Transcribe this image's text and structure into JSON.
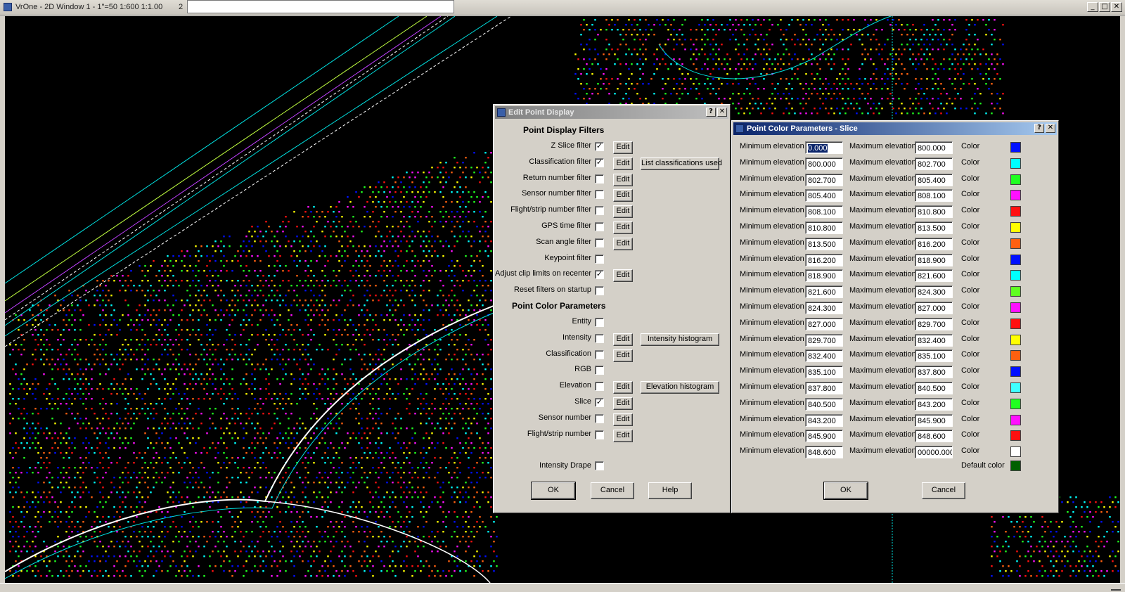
{
  "window": {
    "title": "VrOne - 2D Window 1 - 1\"=50  1:600  1:1.00",
    "title_suffix": "2",
    "minimize": "_",
    "maximize": "□",
    "close": "✕"
  },
  "edit_dialog": {
    "title": "Edit Point Display",
    "help_btn": "?",
    "close_btn": "✕",
    "filters_heading": "Point Display Filters",
    "filters": [
      {
        "label": "Z Slice filter",
        "checked": true,
        "edit": "Edit"
      },
      {
        "label": "Classification filter",
        "checked": true,
        "edit": "Edit",
        "extra": "List classifications used"
      },
      {
        "label": "Return number filter",
        "checked": false,
        "edit": "Edit"
      },
      {
        "label": "Sensor number filter",
        "checked": false,
        "edit": "Edit"
      },
      {
        "label": "Flight/strip number filter",
        "checked": false,
        "edit": "Edit"
      },
      {
        "label": "GPS time filter",
        "checked": false,
        "edit": "Edit"
      },
      {
        "label": "Scan angle filter",
        "checked": false,
        "edit": "Edit"
      },
      {
        "label": "Keypoint filter",
        "checked": false,
        "edit": ""
      },
      {
        "label": "Adjust clip limits on recenter",
        "checked": true,
        "edit": "Edit"
      },
      {
        "label": "Reset filters on startup",
        "checked": false,
        "edit": ""
      }
    ],
    "color_heading": "Point Color Parameters",
    "color_modes": [
      {
        "label": "Entity",
        "checked": false,
        "edit": ""
      },
      {
        "label": "Intensity",
        "checked": false,
        "edit": "Edit",
        "extra": "Intensity histogram"
      },
      {
        "label": "Classification",
        "checked": false,
        "edit": "Edit"
      },
      {
        "label": "RGB",
        "checked": false,
        "edit": ""
      },
      {
        "label": "Elevation",
        "checked": false,
        "edit": "Edit",
        "extra": "Elevation histogram"
      },
      {
        "label": "Slice",
        "checked": true,
        "edit": "Edit"
      },
      {
        "label": "Sensor number",
        "checked": false,
        "edit": "Edit"
      },
      {
        "label": "Flight/strip number",
        "checked": false,
        "edit": "Edit"
      }
    ],
    "drape": {
      "label": "Intensity Drape",
      "checked": false
    },
    "ok": "OK",
    "cancel": "Cancel",
    "help": "Help"
  },
  "slice_dialog": {
    "title": "Point Color Parameters - Slice",
    "help_btn": "?",
    "close_btn": "✕",
    "min_label": "Minimum elevation",
    "max_label": "Maximum elevation",
    "color_label": "Color",
    "rows": [
      {
        "min": "0.000",
        "max": "800.000",
        "color": "#0010ff"
      },
      {
        "min": "800.000",
        "max": "802.700",
        "color": "#00ffff"
      },
      {
        "min": "802.700",
        "max": "805.400",
        "color": "#20ff20"
      },
      {
        "min": "805.400",
        "max": "808.100",
        "color": "#ff10ff"
      },
      {
        "min": "808.100",
        "max": "810.800",
        "color": "#ff1010"
      },
      {
        "min": "810.800",
        "max": "813.500",
        "color": "#ffff00"
      },
      {
        "min": "813.500",
        "max": "816.200",
        "color": "#ff6010"
      },
      {
        "min": "816.200",
        "max": "818.900",
        "color": "#0010ff"
      },
      {
        "min": "818.900",
        "max": "821.600",
        "color": "#00ffff"
      },
      {
        "min": "821.600",
        "max": "824.300",
        "color": "#60ff20"
      },
      {
        "min": "824.300",
        "max": "827.000",
        "color": "#ff10ff"
      },
      {
        "min": "827.000",
        "max": "829.700",
        "color": "#ff1010"
      },
      {
        "min": "829.700",
        "max": "832.400",
        "color": "#ffff00"
      },
      {
        "min": "832.400",
        "max": "835.100",
        "color": "#ff6010"
      },
      {
        "min": "835.100",
        "max": "837.800",
        "color": "#0010ff"
      },
      {
        "min": "837.800",
        "max": "840.500",
        "color": "#40ffff"
      },
      {
        "min": "840.500",
        "max": "843.200",
        "color": "#20ff20"
      },
      {
        "min": "843.200",
        "max": "845.900",
        "color": "#ff10ff"
      },
      {
        "min": "845.900",
        "max": "848.600",
        "color": "#ff1010"
      },
      {
        "min": "848.600",
        "max": "00000.000",
        "color": "#ffffff"
      }
    ],
    "default_color_label": "Default color",
    "default_color": "#006000",
    "ok": "OK",
    "cancel": "Cancel"
  },
  "canvas": {
    "point_colors": [
      "#ff1010",
      "#ff10ff",
      "#20ff20",
      "#00ffff",
      "#ffff00",
      "#ff6010",
      "#0010ff",
      "#ffffff"
    ],
    "line_colors": {
      "road": "#00e0e0",
      "lot": "#c0ff40",
      "median": "#c040ff",
      "edge": "#ffffff"
    }
  }
}
